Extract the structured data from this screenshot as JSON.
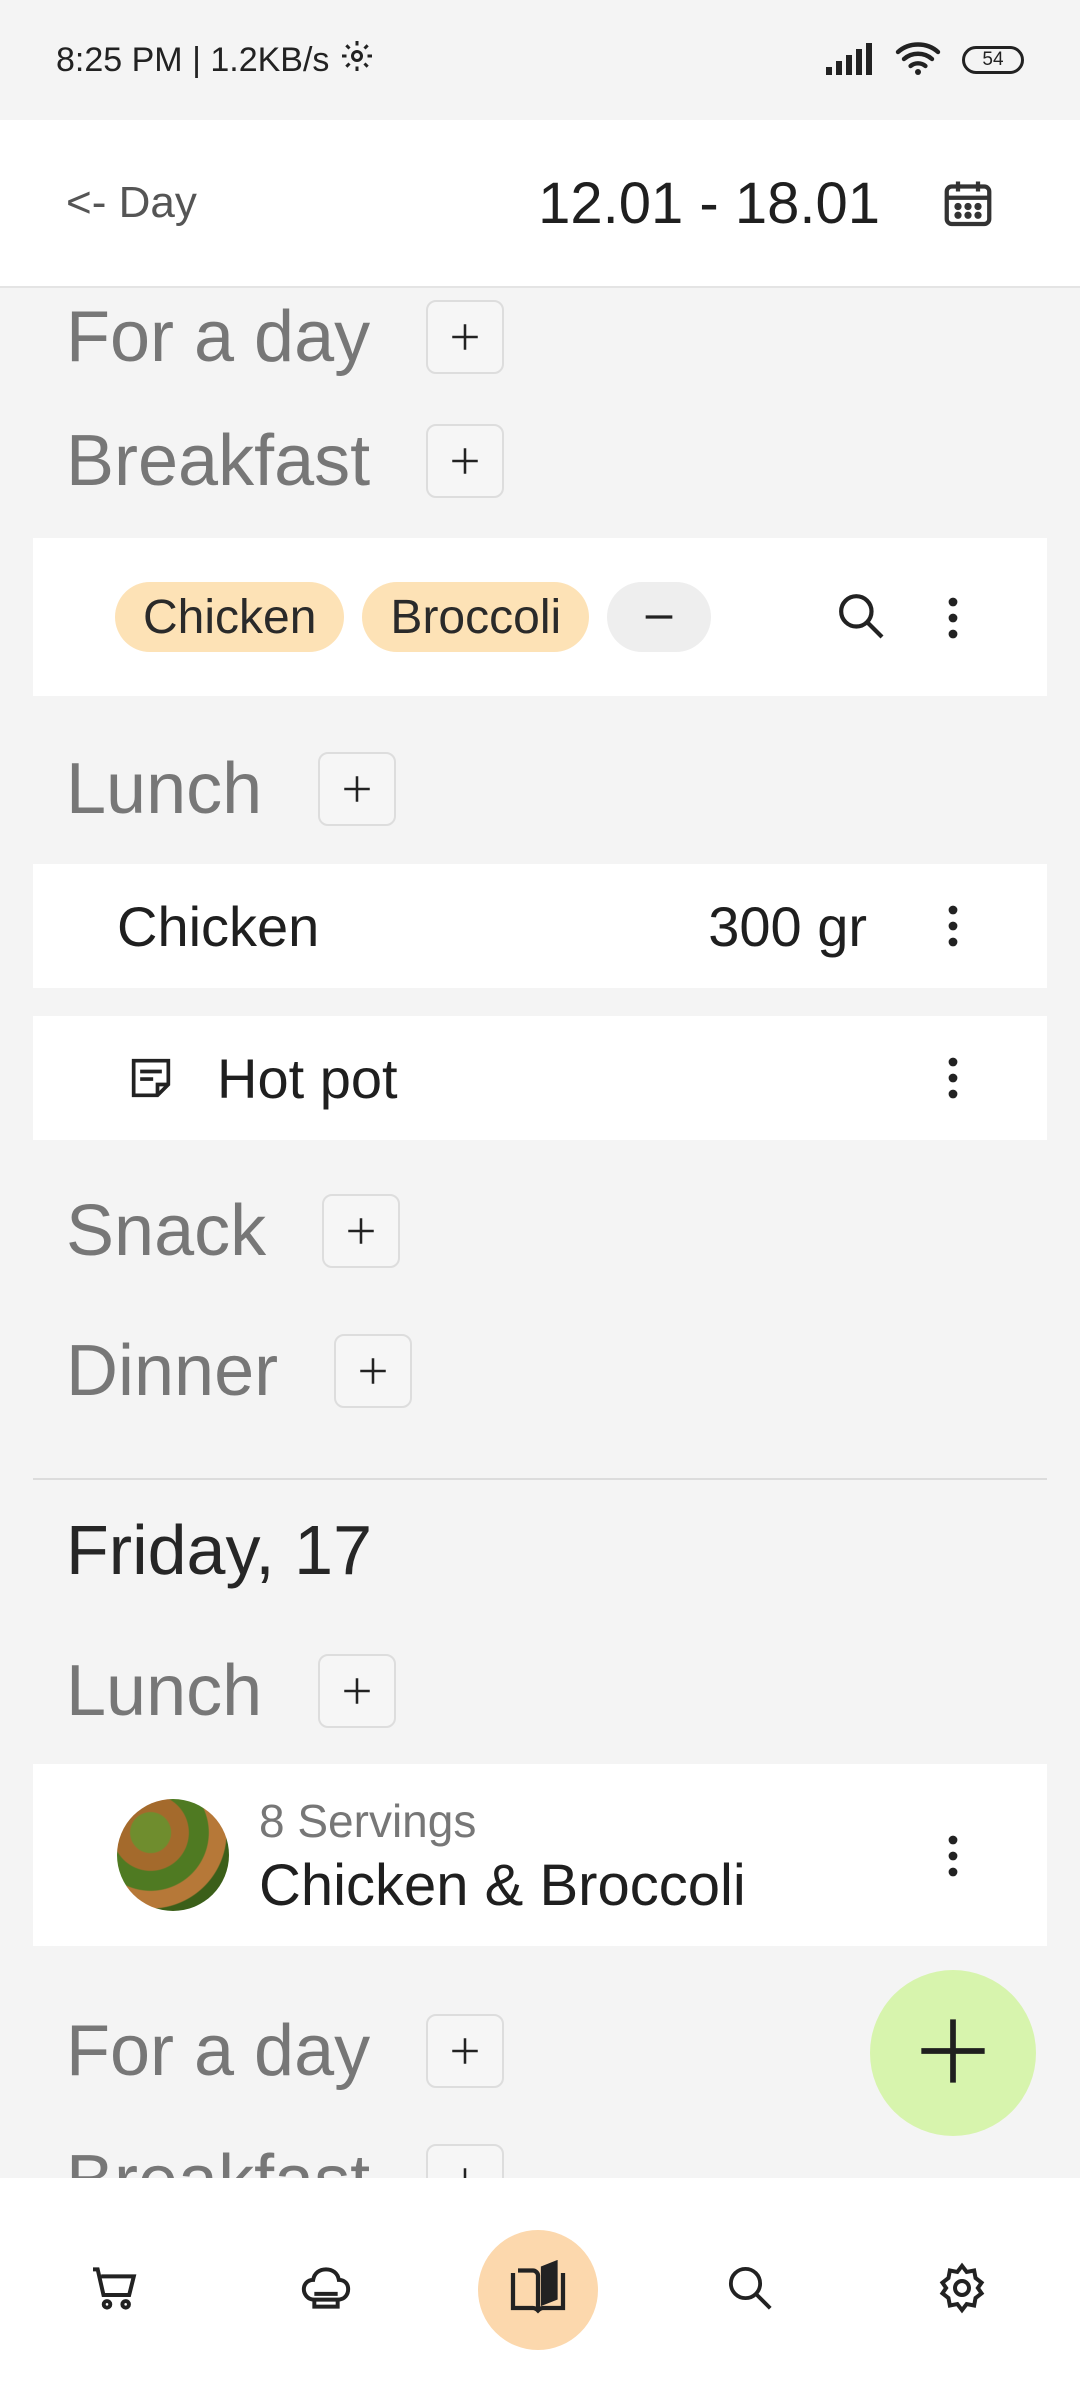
{
  "status_bar": {
    "time_speed": "8:25 PM | 1.2KB/s",
    "battery": "54",
    "icons": [
      "settings-gear-icon",
      "signal-icon",
      "wifi-icon",
      "battery-icon"
    ]
  },
  "header": {
    "back_label": "<- Day",
    "week_range": "12.01 - 18.01",
    "calendar_icon": "calendar-icon"
  },
  "sections": {
    "for_a_day": "For a day",
    "breakfast": "Breakfast",
    "lunch": "Lunch",
    "snack": "Snack",
    "dinner": "Dinner"
  },
  "breakfast_card": {
    "chips": [
      "Chicken",
      "Broccoli"
    ],
    "remove_icon": "minus-icon",
    "search_icon": "search-icon",
    "menu_icon": "more-vertical-icon"
  },
  "lunch_items": [
    {
      "name": "Chicken",
      "amount": "300 gr"
    },
    {
      "name": "Hot pot",
      "icon": "note-icon"
    }
  ],
  "friday": {
    "title": "Friday, 17",
    "lunch": "Lunch",
    "recipe": {
      "servings": "8 Servings",
      "name": "Chicken & Broccoli"
    },
    "for_a_day": "For a day",
    "breakfast_partial": "Breakfast"
  },
  "fab": {
    "icon": "plus-icon"
  },
  "bottom_nav": [
    {
      "icon": "cart-icon",
      "active": false
    },
    {
      "icon": "chef-hat-icon",
      "active": false
    },
    {
      "icon": "book-icon",
      "active": true
    },
    {
      "icon": "search-icon",
      "active": false
    },
    {
      "icon": "settings-icon",
      "active": false
    }
  ],
  "colors": {
    "chip_bg": "#fde2b6",
    "fab_bg": "#d7f4ad",
    "active_nav_bg": "#fcd8ad",
    "page_bg": "#f4f4f4"
  }
}
